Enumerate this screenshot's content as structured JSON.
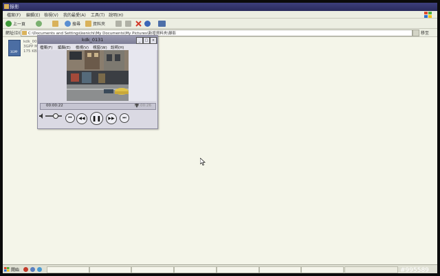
{
  "explorer": {
    "title": "錄影",
    "menus": [
      "檔案(F)",
      "編輯(E)",
      "檢視(V)",
      "我的最愛(A)",
      "工具(T)",
      "說明(H)"
    ],
    "toolbar": {
      "back_label": "上一頁",
      "search_label": "搜尋",
      "folders_label": "資料夾"
    },
    "address": {
      "label": "網址(D)",
      "value": "C:\\Documents and Settings\\kenichi\\My Documents\\My Pictures\\新增資料夾\\錄影",
      "go_label": "移至"
    }
  },
  "file": {
    "icon_badge": "3GPP",
    "name": "kdk_0000",
    "type": "3GPP Me",
    "size": "175 KB"
  },
  "player": {
    "title": "kdk_0131",
    "menus": [
      "檔案(F)",
      "編輯(E)",
      "檢視(V)",
      "視窗(W)",
      "說明(H)"
    ],
    "time_current": "00:00:22",
    "time_total": "00:00:26",
    "progress": 0.85,
    "volume": 0.6,
    "icons": [
      "minimize-icon",
      "maximize-icon",
      "close-icon",
      "volume-icon",
      "skip-start-icon",
      "rewind-icon",
      "pause-icon",
      "fast-forward-icon",
      "skip-end-icon"
    ]
  },
  "taskbar": {
    "start_label": "開始",
    "task_count": 7
  },
  "watermark": "#995589",
  "colors": {
    "screen_bg": "#f4f5e9",
    "titlebar": "#2a2b5c",
    "player_frame": "#dad9e3",
    "bezel": "#0b0b0b"
  }
}
